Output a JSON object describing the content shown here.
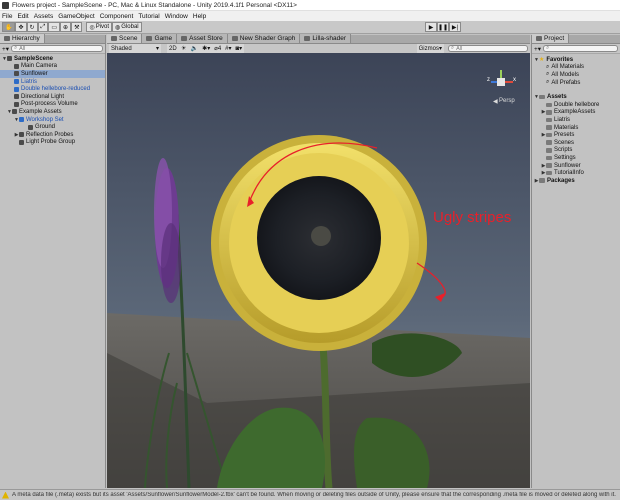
{
  "window": {
    "title": "Flowers project - SampleScene - PC, Mac & Linux Standalone - Unity 2019.4.1f1 Personal <DX11>"
  },
  "menu": [
    "File",
    "Edit",
    "Assets",
    "GameObject",
    "Component",
    "Tutorial",
    "Window",
    "Help"
  ],
  "toolbar": {
    "pivot": "Pivot",
    "global": "Global"
  },
  "hierarchy": {
    "tab": "Hierarchy",
    "search_placeholder": "All",
    "items": [
      {
        "label": "SampleScene"
      },
      {
        "label": "Main Camera"
      },
      {
        "label": "Sunflower"
      },
      {
        "label": "Liatris"
      },
      {
        "label": "Double hellebore-reduced"
      },
      {
        "label": "Directional Light"
      },
      {
        "label": "Post-process Volume"
      },
      {
        "label": "Example Assets"
      },
      {
        "label": "Workshop Set"
      },
      {
        "label": "Ground"
      },
      {
        "label": "Reflection Probes"
      },
      {
        "label": "Light Probe Group"
      }
    ]
  },
  "center_tabs": [
    "Scene",
    "Game",
    "Asset Store",
    "New Shader Graph",
    "Lilla-shader"
  ],
  "scene_toolbar": {
    "shading": "Shaded",
    "mode_2d": "2D",
    "fx_count": "4",
    "gizmos": "Gizmos",
    "search_placeholder": "All"
  },
  "gizmo": {
    "persp": "Persp",
    "axis_x": "x",
    "axis_z": "z",
    "axis_y": "y"
  },
  "annotation": {
    "text": "Ugly stripes",
    "color": "#e8202a"
  },
  "project": {
    "tab": "Project",
    "favorites_header": "Favorites",
    "favorites": [
      "All Materials",
      "All Models",
      "All Prefabs"
    ],
    "assets_header": "Assets",
    "assets": [
      "Double hellebore",
      "ExampleAssets",
      "Liatris",
      "Materials",
      "Presets",
      "Scenes",
      "Scripts",
      "Settings",
      "Sunflower",
      "TutorialInfo"
    ],
    "packages_header": "Packages"
  },
  "status": {
    "message": "A meta data file (.meta) exists but its asset 'Assets/Sunflower/SunflowerModel-2.fbx' can't be found. When moving or deleting files outside of Unity, please ensure that the corresponding .meta file is moved or deleted along with it."
  }
}
